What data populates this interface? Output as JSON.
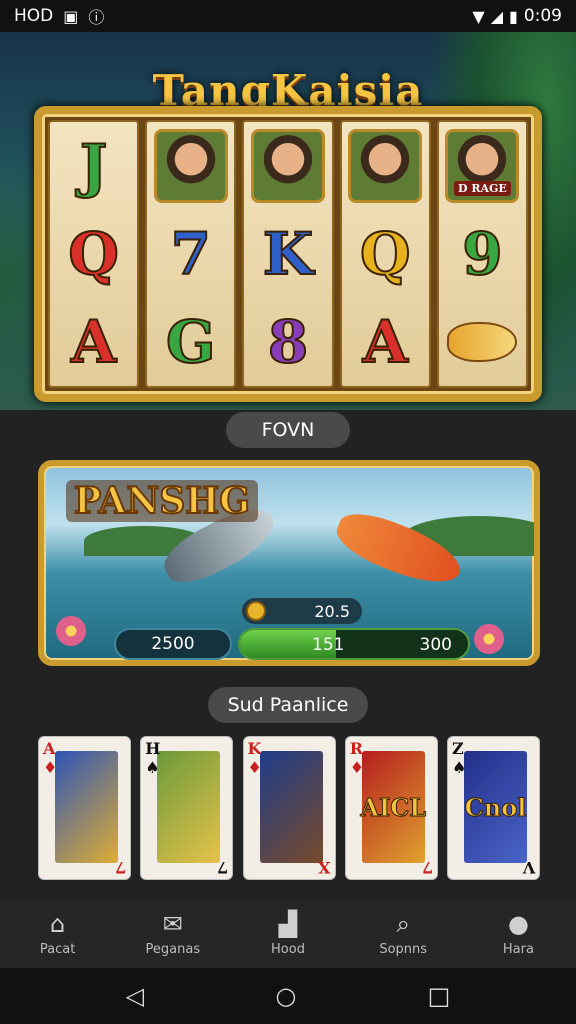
{
  "status_bar": {
    "carrier": "HOD",
    "time": "0:09"
  },
  "slot_machine": {
    "title": "TangKaisia",
    "reels": [
      [
        {
          "type": "letter",
          "text": "J",
          "color": "#3aa641"
        },
        {
          "type": "letter",
          "text": "Q",
          "color": "#d9302a"
        },
        {
          "type": "letter",
          "text": "A",
          "color": "#d9302a"
        }
      ],
      [
        {
          "type": "portrait"
        },
        {
          "type": "letter",
          "text": "7",
          "color": "#2f5fc8"
        },
        {
          "type": "letter",
          "text": "G",
          "color": "#3aa641"
        }
      ],
      [
        {
          "type": "portrait"
        },
        {
          "type": "letter",
          "text": "K",
          "color": "#2f5fc8"
        },
        {
          "type": "letter",
          "text": "8",
          "color": "#8a3db8"
        }
      ],
      [
        {
          "type": "portrait"
        },
        {
          "type": "letter",
          "text": "Q",
          "color": "#e8b21f"
        },
        {
          "type": "letter",
          "text": "A",
          "color": "#d9302a"
        }
      ],
      [
        {
          "type": "portrait",
          "tag": "D RAGE"
        },
        {
          "type": "letter",
          "text": "9",
          "color": "#3aa641"
        },
        {
          "type": "fish"
        }
      ]
    ]
  },
  "section1": {
    "label": "FOVN"
  },
  "fishing": {
    "title": "PANSHG",
    "coin_value": "20.5",
    "left_value": "2500",
    "bar_value1": "151",
    "bar_value2": "300",
    "bar_progress": 0.42
  },
  "section2": {
    "label": "Sud Paanlice"
  },
  "cards": [
    {
      "rank": "A",
      "suit": "♦",
      "corner_br": "7",
      "suit_color": "#c8201c",
      "art_bg": "linear-gradient(135deg,#2b54b8,#e0ad33)",
      "art_text": ""
    },
    {
      "rank": "H",
      "suit": "♠",
      "corner_br": "7",
      "suit_color": "#111",
      "art_bg": "linear-gradient(135deg,#6b9a3a,#e7c24a)",
      "art_text": ""
    },
    {
      "rank": "K",
      "suit": "♦",
      "corner_br": "X",
      "suit_color": "#c8201c",
      "art_bg": "linear-gradient(135deg,#1e3d8a,#7a4a2a)",
      "art_text": ""
    },
    {
      "rank": "R",
      "suit": "♦",
      "corner_br": "7",
      "suit_color": "#c8201c",
      "art_bg": "linear-gradient(135deg,#b51e1e,#e0a22f)",
      "art_text": "AICL"
    },
    {
      "rank": "Z",
      "suit": "♠",
      "corner_br": "V",
      "suit_color": "#111",
      "art_bg": "linear-gradient(135deg,#23308a,#4a64c8)",
      "art_text": "Cnol"
    }
  ],
  "nav": [
    {
      "label": "Pacat",
      "icon": "home-icon"
    },
    {
      "label": "Peganas",
      "icon": "mail-icon"
    },
    {
      "label": "Hood",
      "icon": "bag-icon"
    },
    {
      "label": "Sopnns",
      "icon": "search-icon"
    },
    {
      "label": "Hara",
      "icon": "profile-icon"
    }
  ]
}
